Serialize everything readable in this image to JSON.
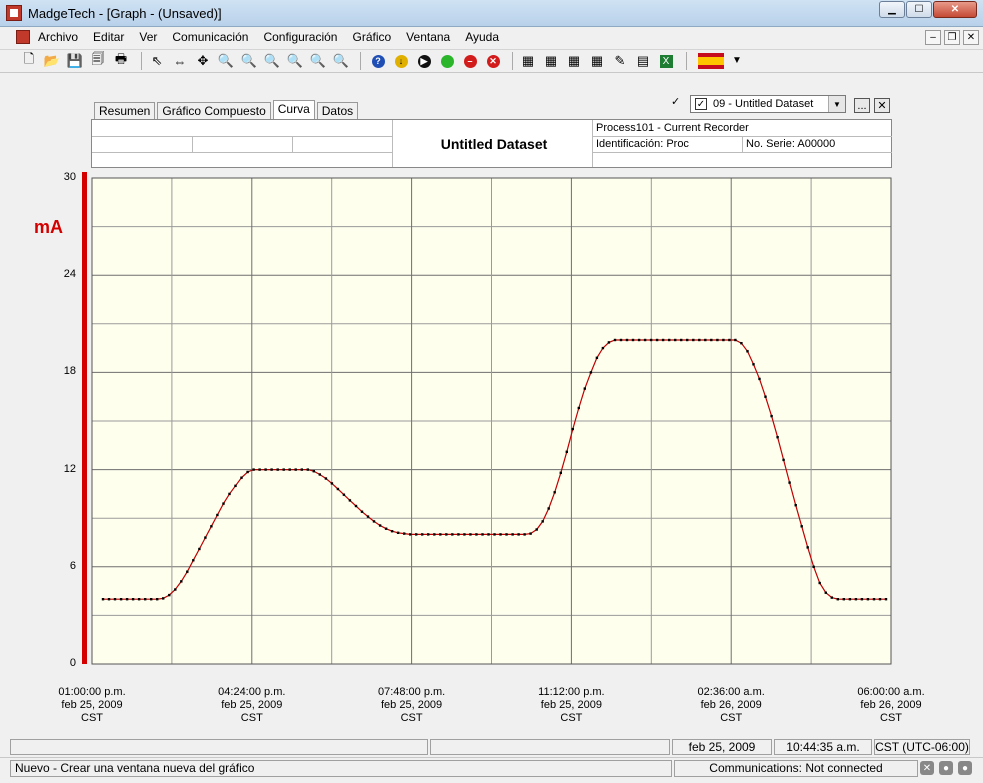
{
  "window": {
    "title": "MadgeTech - [Graph - (Unsaved)]"
  },
  "menu": [
    "Archivo",
    "Editar",
    "Ver",
    "Comunicación",
    "Configuración",
    "Gráfico",
    "Ventana",
    "Ayuda"
  ],
  "tabs": [
    "Resumen",
    "Gráfico Compuesto",
    "Curva",
    "Datos"
  ],
  "active_tab": "Curva",
  "dataset_selector": {
    "label": "09 - Untitled Dataset",
    "more_button": "...",
    "close_button": "✕"
  },
  "header": {
    "dataset_title": "Untitled Dataset",
    "device": "Process101 - Current Recorder",
    "identification": "Identificación: Proc",
    "serial": "No. Serie: A00000"
  },
  "chart_data": {
    "type": "line",
    "ylabel": "mA",
    "ylim": [
      0,
      30
    ],
    "yticks": [
      "0",
      "6",
      "12",
      "18",
      "24",
      "30"
    ],
    "xticks": [
      [
        "01:00:00 p.m.",
        "feb 25, 2009",
        "CST"
      ],
      [
        "04:24:00 p.m.",
        "feb 25, 2009",
        "CST"
      ],
      [
        "07:48:00 p.m.",
        "feb 25, 2009",
        "CST"
      ],
      [
        "11:12:00 p.m.",
        "feb 25, 2009",
        "CST"
      ],
      [
        "02:36:00 a.m.",
        "feb 26, 2009",
        "CST"
      ],
      [
        "06:00:00 a.m.",
        "feb 26, 2009",
        "CST"
      ]
    ],
    "grid": true,
    "line_color": "#c00000",
    "marker_color": "#000000",
    "series": [
      {
        "values": [
          4.0,
          4.0,
          4.0,
          4.0,
          4.0,
          4.0,
          4.0,
          4.0,
          4.0,
          4.0,
          4.05,
          4.25,
          4.6,
          5.1,
          5.7,
          6.4,
          7.1,
          7.8,
          8.5,
          9.2,
          9.9,
          10.5,
          11.0,
          11.5,
          11.85,
          12.0,
          12.0,
          12.0,
          12.0,
          12.0,
          12.0,
          12.0,
          12.0,
          12.0,
          12.0,
          11.9,
          11.7,
          11.45,
          11.15,
          10.8,
          10.45,
          10.1,
          9.75,
          9.4,
          9.1,
          8.8,
          8.55,
          8.35,
          8.2,
          8.1,
          8.05,
          8.0,
          8.0,
          8.0,
          8.0,
          8.0,
          8.0,
          8.0,
          8.0,
          8.0,
          8.0,
          8.0,
          8.0,
          8.0,
          8.0,
          8.0,
          8.0,
          8.0,
          8.0,
          8.0,
          8.0,
          8.05,
          8.3,
          8.8,
          9.6,
          10.6,
          11.8,
          13.1,
          14.5,
          15.8,
          17.0,
          18.0,
          18.9,
          19.5,
          19.85,
          20.0,
          20.0,
          20.0,
          20.0,
          20.0,
          20.0,
          20.0,
          20.0,
          20.0,
          20.0,
          20.0,
          20.0,
          20.0,
          20.0,
          20.0,
          20.0,
          20.0,
          20.0,
          20.0,
          20.0,
          20.0,
          19.8,
          19.3,
          18.5,
          17.6,
          16.5,
          15.3,
          14.0,
          12.6,
          11.2,
          9.8,
          8.5,
          7.2,
          6.0,
          5.0,
          4.4,
          4.1,
          4.0,
          4.0,
          4.0,
          4.0,
          4.0,
          4.0,
          4.0,
          4.0,
          4.0
        ]
      }
    ]
  },
  "status": {
    "date": "feb 25, 2009",
    "time": "10:44:35 a.m.",
    "timezone": "CST (UTC-06:00)",
    "message": "Nuevo - Crear una ventana nueva del gráfico",
    "communications": "Communications: Not connected"
  }
}
